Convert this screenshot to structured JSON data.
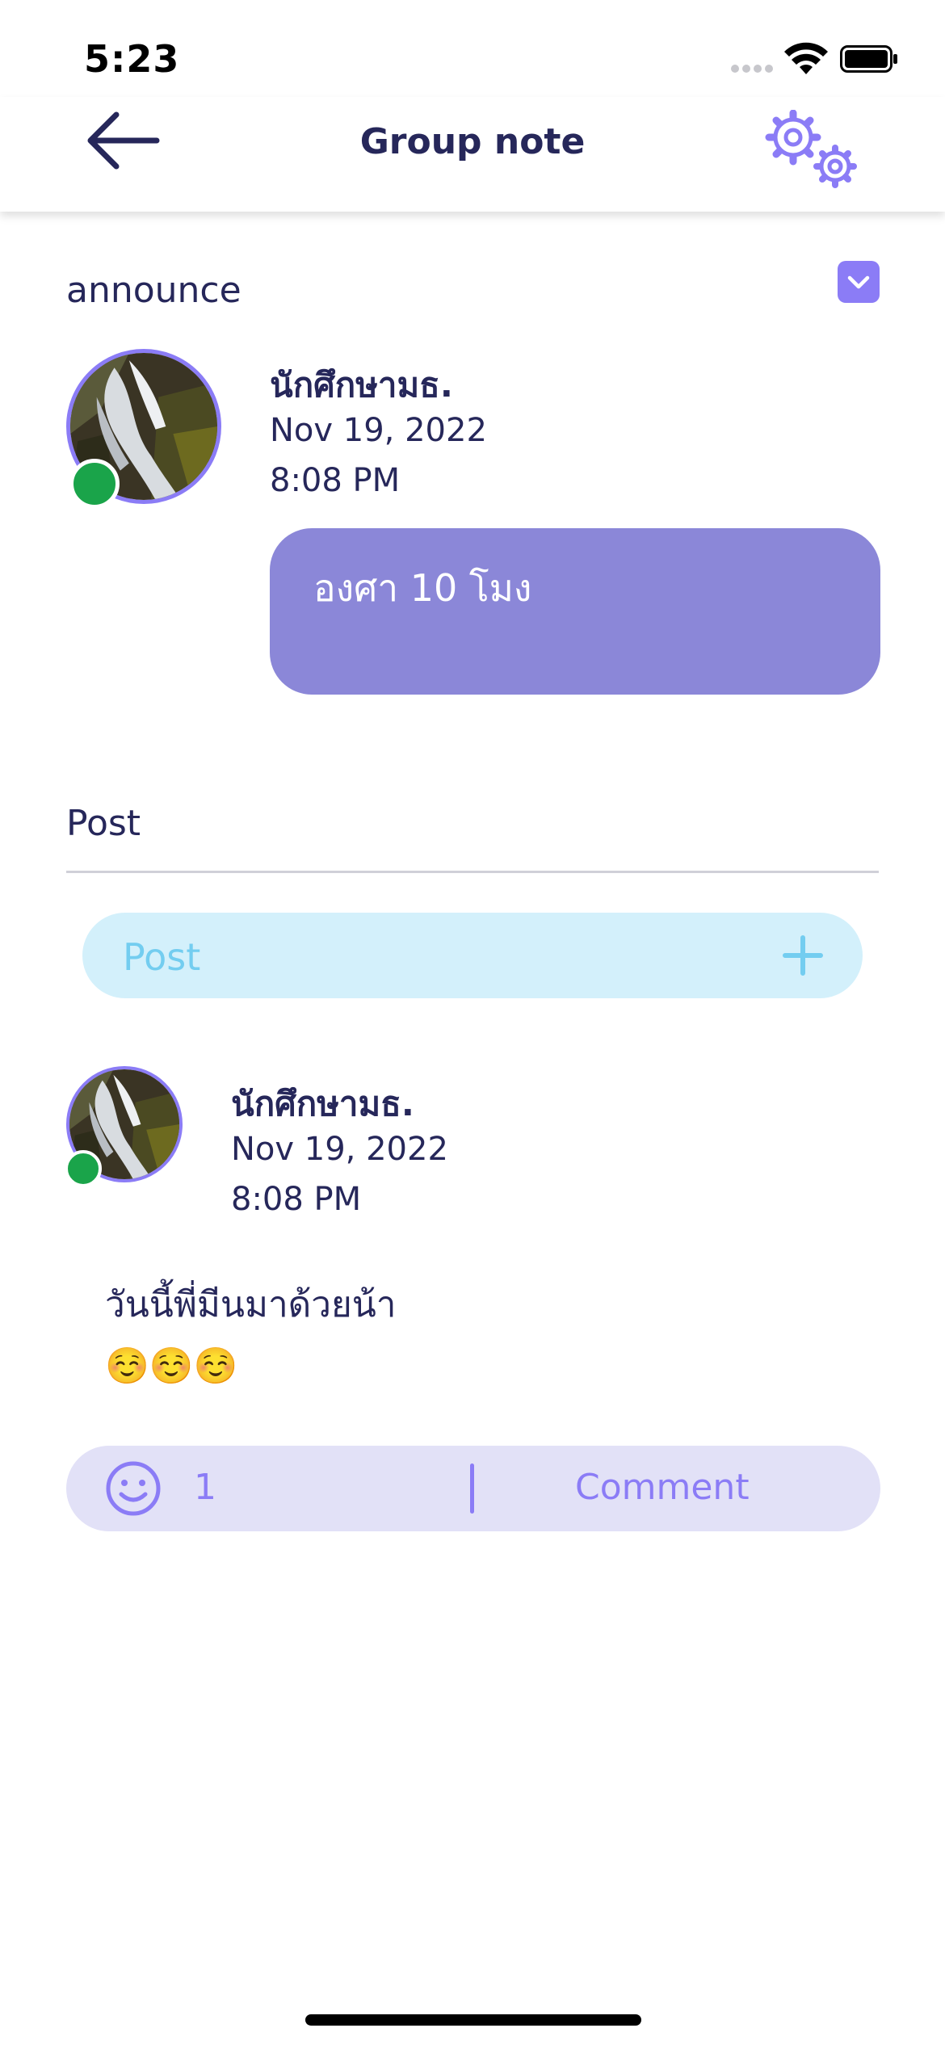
{
  "status_bar": {
    "time": "5:23"
  },
  "header": {
    "title": "Group note"
  },
  "announce": {
    "label": "announce",
    "author": "นักศึกษามธ.",
    "date": "Nov 19, 2022",
    "time": "8:08 PM",
    "message": "องศา 10 โมง"
  },
  "post_section": {
    "label": "Post",
    "input_placeholder": "Post"
  },
  "post": {
    "author": "นักศึกษามธ.",
    "date": "Nov 19, 2022",
    "time": "8:08 PM",
    "text": "วันนี้พี่มีนมาด้วยน้า",
    "emojis": "☺️☺️☺️",
    "reaction_count": "1",
    "comment_label": "Comment"
  },
  "colors": {
    "accent": "#8b7cf6",
    "bubble": "#8b87d8",
    "online": "#1aa44a",
    "text": "#26275a",
    "post_input_bg": "#d3f0fb",
    "actions_bg": "#e2e1f7"
  },
  "icons": [
    "back-arrow-icon",
    "settings-gears-icon",
    "chevron-down-icon",
    "plus-icon",
    "smile-icon",
    "wifi-icon",
    "battery-icon",
    "signal-icon"
  ]
}
